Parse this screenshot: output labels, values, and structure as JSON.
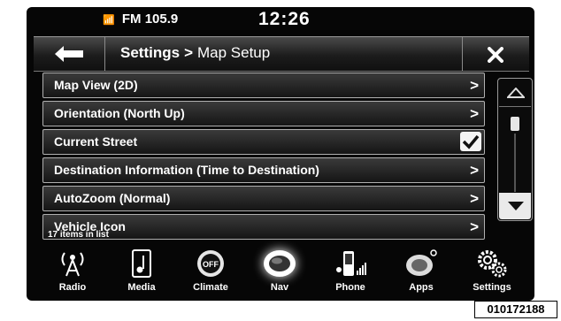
{
  "status": {
    "radio": "FM 105.9",
    "time": "12:26"
  },
  "header": {
    "breadcrumb_parent": "Settings",
    "breadcrumb_sep": ">",
    "breadcrumb_current": "Map Setup"
  },
  "menu": {
    "items": [
      {
        "label": "Map View (2D)",
        "control": "chevron"
      },
      {
        "label": "Orientation (North Up)",
        "control": "chevron"
      },
      {
        "label": "Current Street",
        "control": "checkbox",
        "checked": true
      },
      {
        "label": "Destination Information (Time to Destination)",
        "control": "chevron"
      },
      {
        "label": "AutoZoom (Normal)",
        "control": "chevron"
      },
      {
        "label": "Vehicle Icon",
        "control": "chevron"
      }
    ],
    "chevron_glyph": ">",
    "item_count": "17 items in list"
  },
  "dock": {
    "items": [
      {
        "label": "Radio",
        "icon": "radio-antenna-icon"
      },
      {
        "label": "Media",
        "icon": "media-note-icon"
      },
      {
        "label": "Climate",
        "icon": "climate-off-icon"
      },
      {
        "label": "Nav",
        "icon": "nav-globe-icon",
        "active": true
      },
      {
        "label": "Phone",
        "icon": "phone-signal-icon"
      },
      {
        "label": "Apps",
        "icon": "apps-icon"
      },
      {
        "label": "Settings",
        "icon": "settings-gears-icon"
      }
    ],
    "climate_icon_text": "OFF"
  },
  "figure_code": "010172188",
  "colors": {
    "screen": "#060606",
    "text": "#ffffff",
    "border": "#b0b0b0"
  }
}
